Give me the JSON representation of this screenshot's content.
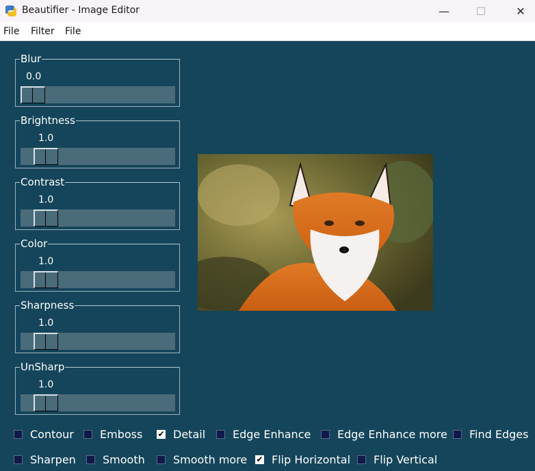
{
  "window": {
    "title": "Beautifier - Image Editor",
    "minimize": "—",
    "maximize": "☐",
    "close": "✕"
  },
  "menu": [
    "File",
    "Filter",
    "File"
  ],
  "sliders": [
    {
      "label": "Blur",
      "value": "0.0"
    },
    {
      "label": "Brightness",
      "value": "1.0"
    },
    {
      "label": "Contrast",
      "value": "1.0"
    },
    {
      "label": "Color",
      "value": "1.0"
    },
    {
      "label": "Sharpness",
      "value": "1.0"
    },
    {
      "label": "UnSharp",
      "value": "1.0"
    }
  ],
  "checkboxes": [
    {
      "label": "Contour",
      "checked": false
    },
    {
      "label": "Emboss",
      "checked": false
    },
    {
      "label": "Detail",
      "checked": true
    },
    {
      "label": "Edge Enhance",
      "checked": false
    },
    {
      "label": "Edge Enhance more",
      "checked": false
    },
    {
      "label": "Find Edges",
      "checked": false
    },
    {
      "label": "Sharpen",
      "checked": false
    },
    {
      "label": "Smooth",
      "checked": false
    },
    {
      "label": "Smooth more",
      "checked": false
    },
    {
      "label": "Flip Horizontal",
      "checked": true
    },
    {
      "label": "Flip Vertical",
      "checked": false
    }
  ],
  "checkmark": "✔",
  "image": {
    "subject": "fox-photo"
  }
}
